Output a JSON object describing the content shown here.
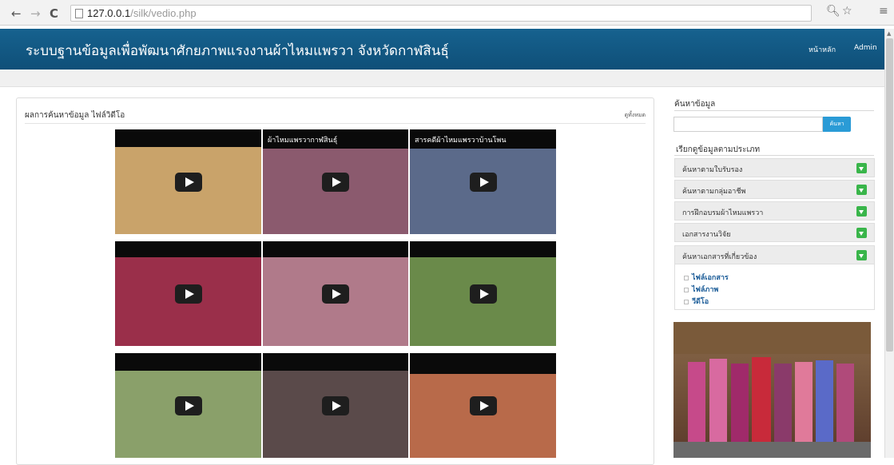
{
  "browser": {
    "url_host": "127.0.0.1",
    "url_path": "/silk/vedio.php"
  },
  "header": {
    "site_title": "ระบบฐานข้อมูลเพื่อพัฒนาศักยภาพแรงงานผ้าไหมแพรวา จังหวัดกาฬสินธุ์",
    "nav": [
      "หน้าหลัก",
      "Admin"
    ]
  },
  "main": {
    "title": "ผลการค้นหาข้อมูล ไฟล์วิดีโอ",
    "view_all": "ดูทั้งหมด",
    "videos": [
      {
        "title": "",
        "scene": "#c9a36a"
      },
      {
        "title": "ผ้าไหมแพรวากาฬสินธุ์",
        "scene": "#8b5a6e"
      },
      {
        "title": "สารคดีผ้าไหมแพรวาบ้านโพน",
        "scene": "#5b6a8a"
      },
      {
        "title": "",
        "scene": "#9a2f4a"
      },
      {
        "title": "",
        "scene": "#b07a8a"
      },
      {
        "title": "",
        "scene": "#6a8a4a"
      },
      {
        "title": "",
        "scene": "#8aa06a"
      },
      {
        "title": "",
        "scene": "#5a4a4a"
      },
      {
        "title": "",
        "scene": "#b86a4a"
      }
    ]
  },
  "sidebar": {
    "search_label": "ค้นหาข้อมูล",
    "search_placeholder": "",
    "search_button": "ค้นหา",
    "category_label": "เรียกดูข้อมูลตามประเภท",
    "categories": [
      "ค้นหาตามใบรับรอง",
      "ค้นหาตามกลุ่มอาชีพ",
      "การฝึกอบรมผ้าไหมแพรวา",
      "เอกสารงานวิจัย",
      "ค้นหาเอกสารที่เกี่ยวข้อง"
    ],
    "sub_items": [
      "ไฟล์เอกสาร",
      "ไฟล์ภาพ",
      "วีดีโอ"
    ]
  },
  "colors": {
    "header_bg": "#16628f",
    "accent_green": "#39b54a",
    "search_button": "#2a9bd6"
  }
}
